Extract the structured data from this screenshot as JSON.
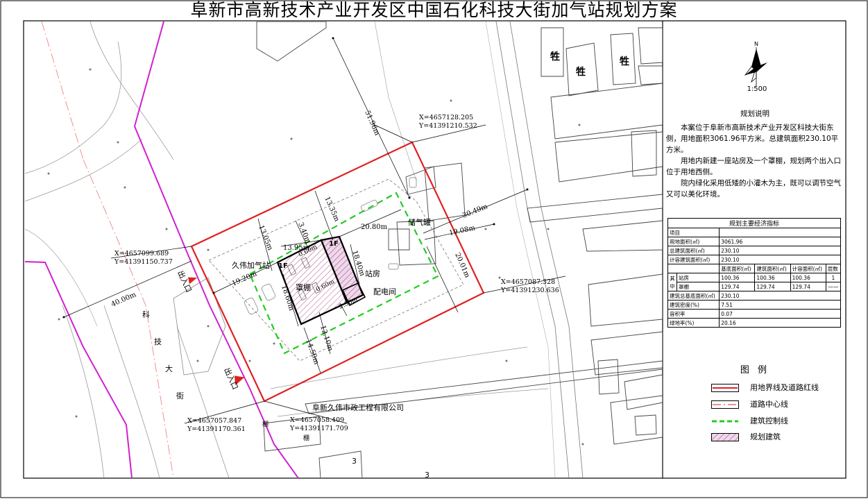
{
  "title": "阜新市高新技术产业开发区中国石化科技大街加气站规划方案",
  "compass": {
    "north": "N",
    "scale": "1:500"
  },
  "notes": {
    "heading": "规划说明",
    "paragraphs": [
      "本案位于阜新市高新技术产业开发区科技大街东侧，用地面积3061.96平方米。总建筑面积230.10平方米。",
      "用地内新建一座站房及一个罩棚，规划两个出入口位于用地西侧。",
      "院内绿化采用低矮的小灌木为主，既可以调节空气又可以美化环境。"
    ]
  },
  "indicators": {
    "caption": "规划主要经济指标",
    "item_label": "项目",
    "site_area_label": "用地面积(㎡)",
    "site_area": "3061.96",
    "total_floor_label": "总建筑面积(㎡)",
    "total_floor": "230.10",
    "gfa_label": "计容建筑面积(㎡)",
    "gfa": "230.10",
    "cols": [
      "基底面积(㎡)",
      "建筑面积(㎡)",
      "计容面积(㎡)",
      "层数"
    ],
    "group_label": "其中",
    "rows": [
      {
        "name": "站房",
        "base": "100.36",
        "floor": "100.36",
        "gfa": "100.36",
        "levels": "1"
      },
      {
        "name": "罩棚",
        "base": "129.74",
        "floor": "129.74",
        "gfa": "129.74",
        "levels": "——"
      }
    ],
    "footprint_label": "建筑总基底面积(㎡)",
    "footprint": "230.10",
    "density_label": "建筑密度(%)",
    "density": "7.51",
    "far_label": "容积率",
    "far": "0.07",
    "green_label": "绿地率(%)",
    "green": "20.16"
  },
  "legend": {
    "title": "图  例",
    "items": [
      {
        "label": "用地界线及道路红线",
        "color": "#e02020"
      },
      {
        "label": "道路中心线",
        "color": "#e02020"
      },
      {
        "label": "建筑控制线",
        "color": "#22cc22"
      },
      {
        "label": "规划建筑",
        "color": "#b0508c"
      }
    ]
  },
  "coords": [
    {
      "x": "X=4657128.205",
      "y": "Y=41391210.532"
    },
    {
      "x": "X=4657099.689",
      "y": "Y=41391150.737"
    },
    {
      "x": "X=4657087.328",
      "y": "Y=41391230.636"
    },
    {
      "x": "X=4657057.847",
      "y": "Y=41391170.361"
    },
    {
      "x": "X=4657058.409",
      "y": "Y=41391171.709"
    }
  ],
  "dimensions": {
    "d5196": "51.96m",
    "d1335": "13.35m",
    "d1305": "13.05m",
    "d340": "3.40m",
    "d1395": "13.95m",
    "d2080": "20.80m",
    "d3049": "30.49m",
    "d1908": "19.08m",
    "d2001": "20.01m",
    "d1840": "18.40m",
    "d4000": "40.00m",
    "d1920": "19.20m",
    "d1860": "18.60m",
    "d1210": "12.10m",
    "d1450": "14.50m",
    "d250": "2.50m",
    "d060": "0.60m"
  },
  "site_labels": {
    "station_name": "久伟加气站",
    "floor_1f": "1F",
    "canopy": "罩棚",
    "station_house": "站房",
    "power_room": "配电间",
    "tank": "储气罐",
    "entrance": "出入口",
    "company": "阜新久伟市政工程有限公司",
    "street": [
      "科",
      "技",
      "大",
      "街"
    ],
    "map_marks": [
      "牲",
      "牲",
      "牲",
      "棚",
      "棚",
      "3",
      "3"
    ]
  }
}
